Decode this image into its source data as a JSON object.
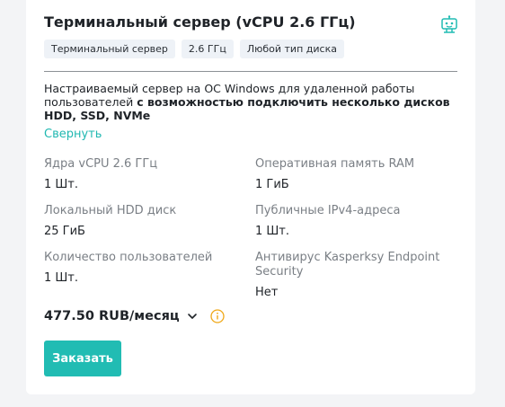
{
  "card": {
    "title": "Терминальный сервер (vCPU 2.6 ГГц)",
    "header_icon": "server-support-icon",
    "tags": [
      "Терминальный сервер",
      "2.6 ГГц",
      "Любой тип диска"
    ],
    "description_plain": "Настраиваемый сервер на ОС Windows для удаленной работы пользователей ",
    "description_bold": "с возможностью подключить несколько дисков HDD, SSD, NVMe",
    "collapse_label": "Свернуть",
    "specs": [
      {
        "label": "Ядра vCPU 2.6 ГГц",
        "value": "1 Шт."
      },
      {
        "label": "Оперативная память RAM",
        "value": "1 ГиБ"
      },
      {
        "label": "Локальный HDD диск",
        "value": "25 ГиБ"
      },
      {
        "label": "Публичные IPv4-адреса",
        "value": "1 Шт."
      },
      {
        "label": "Количество пользователей",
        "value": "1 Шт."
      },
      {
        "label": "Антивирус Kasperksy Endpoint Security",
        "value": "Нет"
      }
    ],
    "price": "477.50 RUB/месяц",
    "order_label": "Заказать"
  },
  "colors": {
    "accent": "#21bcb3",
    "link": "#20b8b1",
    "info_icon": "#f0a818",
    "tag_bg": "#eef2f7",
    "muted_text": "#7a7f85"
  }
}
